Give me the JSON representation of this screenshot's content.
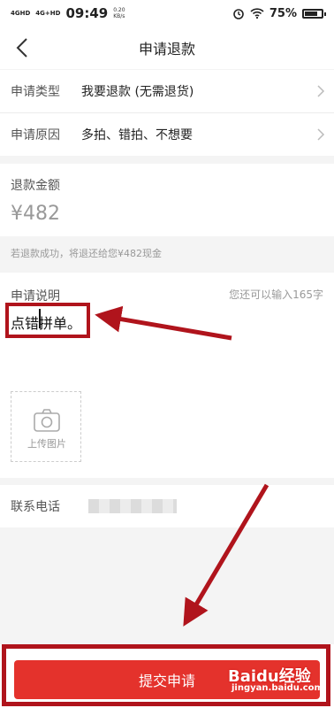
{
  "status_bar": {
    "network_1": "4GHD",
    "network_2": "4G+HD",
    "time": "09:49",
    "speed": "0.20",
    "speed_unit": "KB/s",
    "battery": "75%",
    "battery_level": 0.75
  },
  "nav": {
    "title": "申请退款"
  },
  "form": {
    "type_label": "申请类型",
    "type_value": "我要退款 (无需退货)",
    "reason_label": "申请原因",
    "reason_value": "多拍、错拍、不想要",
    "refund_label": "退款金额",
    "refund_amount": "¥482",
    "refund_note": "若退款成功，将退还给您¥482现金",
    "desc_label": "申请说明",
    "desc_counter": "您还可以输入165字",
    "desc_text": "点错拼单。",
    "upload_label": "上传图片",
    "phone_label": "联系电话"
  },
  "footer": {
    "submit_label": "提交申请",
    "watermark": "Baidu经验",
    "watermark_url": "jingyan.baidu.com"
  },
  "colors": {
    "primary": "#e4322c",
    "annotation": "#b0141c"
  }
}
